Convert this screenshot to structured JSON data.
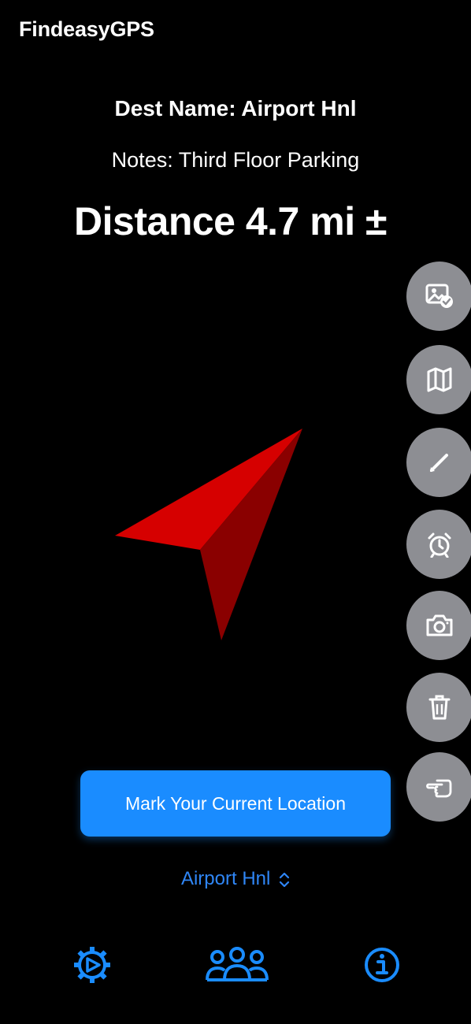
{
  "app": {
    "title": "FindeasyGPS"
  },
  "destination": {
    "name_label": "Dest Name: Airport Hnl",
    "notes_label": "Notes: Third Floor Parking",
    "distance_label": "Distance 4.7 mi ±"
  },
  "actions": [
    {
      "icon": "photo-check-icon"
    },
    {
      "icon": "map-icon"
    },
    {
      "icon": "pencil-icon"
    },
    {
      "icon": "alarm-clock-icon"
    },
    {
      "icon": "camera-icon"
    },
    {
      "icon": "trash-icon"
    },
    {
      "icon": "pointing-hand-icon"
    }
  ],
  "mark_button": {
    "label": "Mark Your Current Location"
  },
  "destination_picker": {
    "selected": "Airport Hnl"
  },
  "tabbar": [
    {
      "icon": "settings-icon"
    },
    {
      "icon": "group-icon"
    },
    {
      "icon": "info-icon"
    }
  ],
  "colors": {
    "background": "#000000",
    "accent": "#1a8cff",
    "picker_text": "#2f86f6",
    "fab": "#8d8e93",
    "arrow_light": "#d60000",
    "arrow_dark": "#8a0000"
  }
}
